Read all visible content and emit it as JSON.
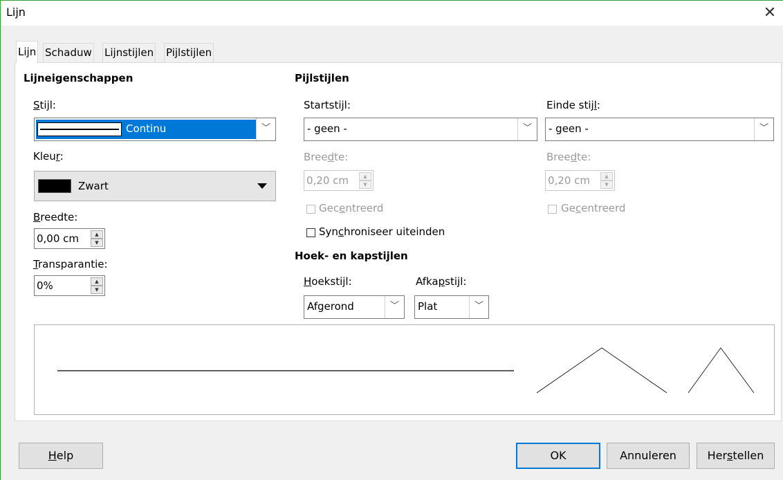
{
  "window": {
    "title": "Lijn",
    "close_icon": "close-icon"
  },
  "tabs": [
    "Lijn",
    "Schaduw",
    "Lijnstijlen",
    "Pijlstijlen"
  ],
  "line_properties": {
    "heading": "Lijneigenschappen",
    "style_label": "Stijl:",
    "style_value": "Continu",
    "color_label": "Kleur:",
    "color_value": "Zwart",
    "color_swatch": "#000000",
    "width_label": "Breedte:",
    "width_value": "0,00 cm",
    "transparency_label": "Transparantie:",
    "transparency_value": "0%"
  },
  "arrow_styles": {
    "heading": "Pijlstijlen",
    "start_label": "Startstijl:",
    "start_value": "- geen -",
    "end_label": "Einde stijl:",
    "end_value": "- geen -",
    "start_width_label": "Breedte:",
    "start_width_value": "0,20 cm",
    "end_width_label": "Breedte:",
    "end_width_value": "0,20 cm",
    "start_centered_label": "Gecentreerd",
    "end_centered_label": "Gecentreerd",
    "sync_label": "Synchroniseer uiteinden"
  },
  "corner_cap": {
    "heading": "Hoek- en kapstijlen",
    "corner_label": "Hoekstijl:",
    "corner_value": "Afgerond",
    "cap_label": "Afkapstijl:",
    "cap_value": "Plat"
  },
  "buttons": {
    "help": "Help",
    "ok": "OK",
    "cancel": "Annuleren",
    "reset": "Herstellen"
  },
  "colors": {
    "accent": "#0078d7",
    "selection": "#0078d7"
  }
}
